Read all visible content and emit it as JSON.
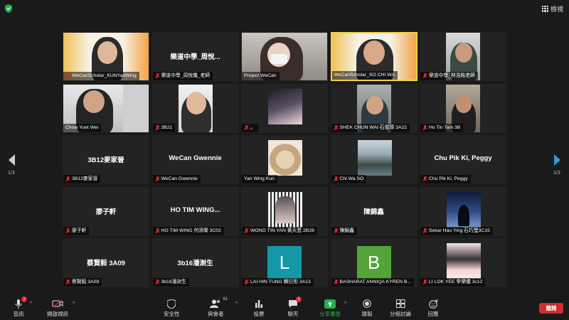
{
  "topbar": {
    "view_label": "檢視"
  },
  "pager": {
    "left": "1/3",
    "right": "1/3"
  },
  "tiles": [
    {
      "label": "WeCanScholar_KUNYanWing"
    },
    {
      "center": "樂道中學_周悅...",
      "label": "樂道中學_周悅儀_老師"
    },
    {
      "label": "Project WeCan"
    },
    {
      "label": "WeCanScholar_SO CHI WA"
    },
    {
      "label": "樂道中學_林浩銘老師"
    },
    {
      "label": "Chow Yuet Wei"
    },
    {
      "label": "3B21"
    },
    {
      "label": "。"
    },
    {
      "label": "SHEK CHUN WAI 石俊瑋 3A22"
    },
    {
      "label": "Ho Tin Tam 3B"
    },
    {
      "center": "3B12麥家晉",
      "label": "3B12麥家晉"
    },
    {
      "center": "WeCan Gwennie",
      "label": "WeCan Gwennie"
    },
    {
      "label": "Yan Wing Kun"
    },
    {
      "label": "Chi Wa SO"
    },
    {
      "center": "Chu Pik Ki, Peggy",
      "label": "Chu Pik Ki, Peggy"
    },
    {
      "center": "廖子軒",
      "label": "廖子軒"
    },
    {
      "center": "HO TIM WING...",
      "label": "HO TIM WING 何添榮 3C02"
    },
    {
      "label": "WONG TIN YAN 黃天恩 2B28"
    },
    {
      "center": "陳錦鑫",
      "label": "陳錦鑫"
    },
    {
      "label": "Sekar Hau Ying 石巧瑩3C15"
    },
    {
      "center": "蔡賢毅 3A09",
      "label": "蔡賢毅 3A09"
    },
    {
      "center": "3b16潘澍生",
      "label": "3b16潘澍生"
    },
    {
      "letter": "L",
      "label": "LAI HIN TUNG 賴衍彤 3A13"
    },
    {
      "letter": "B",
      "label": "BASHARAT ANNIQA KYREN B..."
    },
    {
      "label": "LI LOK YEE 李樂儀 3c12"
    }
  ],
  "toolbar": {
    "audio": "音訊",
    "audio_badge": "1",
    "video": "開啟視訊",
    "security": "安全性",
    "participants": "與會者",
    "participants_count": "61",
    "polls": "投票",
    "chat": "聊天",
    "chat_badge": "1",
    "share": "分享畫面",
    "record": "錄製",
    "breakout": "分組討論",
    "reactions": "回應",
    "leave": "離開"
  },
  "colors": {
    "background": "#1a1a1a",
    "tile": "#232323",
    "active_border": "#f0d24a",
    "share_green": "#23b14d",
    "leave_red": "#d22c2c",
    "letter_L": "#1597a7",
    "letter_B": "#53a43a",
    "pager_arrow_right": "#2d9cdb"
  }
}
